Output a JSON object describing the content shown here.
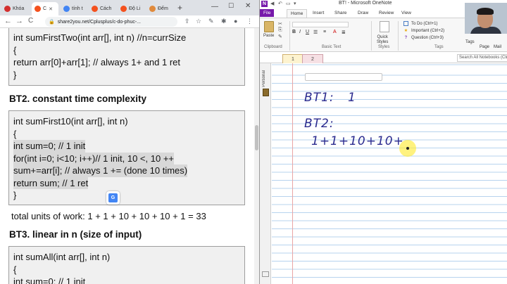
{
  "browser": {
    "tabs": [
      {
        "label": "Khóa",
        "color": "#d32f2f"
      },
      {
        "label": "C",
        "color": "#f4511e"
      },
      {
        "label": "tính t",
        "color": "#4285f4"
      },
      {
        "label": "Cách",
        "color": "#f4511e"
      },
      {
        "label": "Độ Li",
        "color": "#f4511e"
      },
      {
        "label": "Đếm",
        "color": "#e08a3c"
      }
    ],
    "new_tab": "+",
    "url": "share2you.net/Cplusplus/c-do-phuc-...",
    "nav": {
      "back": "←",
      "forward": "→",
      "reload": "C"
    }
  },
  "article": {
    "block1": [
      "int sumFirstTwo(int arr[], int n) //n=currSize",
      "{",
      "return arr[0]+arr[1]; // always 1+ and 1 ret",
      "}"
    ],
    "heading2": "BT2. constant time complexity",
    "block2": [
      "int sumFirst10(int arr[], int n)",
      "{",
      "int sum=0; // 1 init",
      "for(int i=0; i<10; i++)// 1 init, 10 <, 10 ++",
      "sum+=arr[i]; // always 1 += (done 10 times)",
      "return sum; // 1 ret",
      "}"
    ],
    "summary": "total units of work: 1 + 1 + 10 + 10 + 10 + 1 = 33",
    "heading3": "BT3. linear in n (size of input)",
    "block3": [
      "int sumAll(int arr[], int n)",
      "{",
      "int sum=0; // 1 init"
    ]
  },
  "onenote": {
    "title": "BT! - Microsoft OneNote",
    "ribbon_tabs": [
      "File",
      "Home",
      "Insert",
      "Share",
      "Draw",
      "Review",
      "View"
    ],
    "clipboard": {
      "paste": "Paste",
      "label": "Clipboard"
    },
    "basic_text_label": "Basic Text",
    "styles_label": "Styles",
    "styles_button": "Quick\nStyles",
    "tags": [
      {
        "label": "To Do (Ctrl+1)",
        "mark": "☐"
      },
      {
        "label": "Important (Ctrl+2)",
        "mark": "★"
      },
      {
        "label": "Question (Ctrl+3)",
        "mark": "?"
      }
    ],
    "tags_label": "Tags",
    "right_labels": [
      "Tags",
      "Page",
      "Mail"
    ],
    "search_placeholder": "Search All Notebooks (Ctrl+E)",
    "page_tabs": [
      "1",
      "2"
    ],
    "notebook_label": "Personal",
    "handwriting": {
      "line1_a": "BT1:",
      "line1_b": "1",
      "line2": "BT2:",
      "line3": "1+1+10+10+"
    }
  }
}
